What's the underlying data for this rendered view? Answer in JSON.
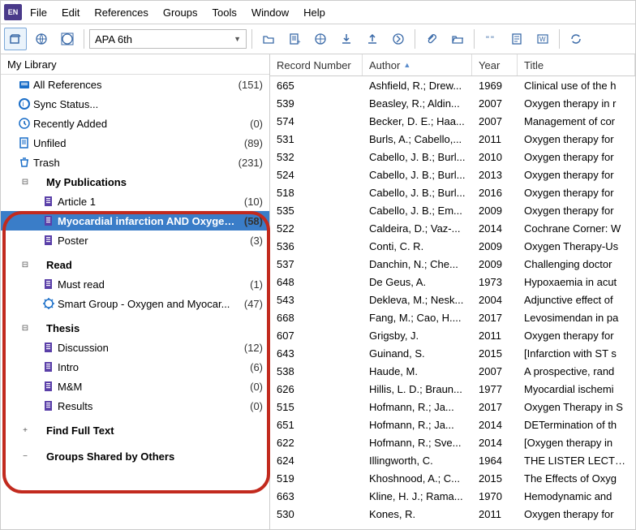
{
  "menubar": {
    "items": [
      "File",
      "Edit",
      "References",
      "Groups",
      "Tools",
      "Window",
      "Help"
    ],
    "logo": "EN"
  },
  "toolbar": {
    "style": "APA 6th"
  },
  "sidebar": {
    "header": "My Library",
    "top": [
      {
        "icon": "refs",
        "label": "All References",
        "count": "(151)"
      },
      {
        "icon": "sync",
        "label": "Sync Status..."
      },
      {
        "icon": "recent",
        "label": "Recently Added",
        "count": "(0)"
      },
      {
        "icon": "unfiled",
        "label": "Unfiled",
        "count": "(89)"
      },
      {
        "icon": "trash",
        "label": "Trash",
        "count": "(231)"
      }
    ],
    "groups": [
      {
        "name": "My Publications",
        "expanded": true,
        "items": [
          {
            "label": "Article 1",
            "count": "(10)"
          },
          {
            "label": "Myocardial infarction AND Oxygen ...",
            "count": "(58)",
            "selected": true
          },
          {
            "label": "Poster",
            "count": "(3)"
          }
        ]
      },
      {
        "name": "Read",
        "expanded": true,
        "items": [
          {
            "label": "Must read",
            "count": "(1)"
          },
          {
            "label": "Smart Group - Oxygen and Myocar...",
            "count": "(47)",
            "smart": true
          }
        ]
      },
      {
        "name": "Thesis",
        "expanded": true,
        "items": [
          {
            "label": "Discussion",
            "count": "(12)"
          },
          {
            "label": "Intro",
            "count": "(6)"
          },
          {
            "label": "M&M",
            "count": "(0)"
          },
          {
            "label": "Results",
            "count": "(0)"
          }
        ]
      }
    ],
    "bottom": [
      {
        "exp": "+",
        "label": "Find Full Text"
      },
      {
        "exp": "−",
        "label": "Groups Shared by Others"
      }
    ]
  },
  "columns": {
    "rec": "Record Number",
    "author": "Author",
    "year": "Year",
    "title": "Title"
  },
  "records": [
    {
      "n": "665",
      "a": "Ashfield, R.; Drew...",
      "y": "1969",
      "t": "Clinical use of the h"
    },
    {
      "n": "539",
      "a": "Beasley, R.; Aldin...",
      "y": "2007",
      "t": "Oxygen therapy in r"
    },
    {
      "n": "574",
      "a": "Becker, D. E.; Haa...",
      "y": "2007",
      "t": "Management of cor"
    },
    {
      "n": "531",
      "a": "Burls, A.; Cabello,...",
      "y": "2011",
      "t": "Oxygen therapy for"
    },
    {
      "n": "532",
      "a": "Cabello, J. B.; Burl...",
      "y": "2010",
      "t": "Oxygen therapy for"
    },
    {
      "n": "524",
      "a": "Cabello, J. B.; Burl...",
      "y": "2013",
      "t": "Oxygen therapy for"
    },
    {
      "n": "518",
      "a": "Cabello, J. B.; Burl...",
      "y": "2016",
      "t": "Oxygen therapy for"
    },
    {
      "n": "535",
      "a": "Cabello, J. B.; Em...",
      "y": "2009",
      "t": "Oxygen therapy for"
    },
    {
      "n": "522",
      "a": "Caldeira, D.; Vaz-...",
      "y": "2014",
      "t": "Cochrane Corner: W"
    },
    {
      "n": "536",
      "a": "Conti, C. R.",
      "y": "2009",
      "t": "Oxygen Therapy-Us"
    },
    {
      "n": "537",
      "a": "Danchin, N.; Che...",
      "y": "2009",
      "t": "Challenging doctor"
    },
    {
      "n": "648",
      "a": "De Geus, A.",
      "y": "1973",
      "t": "Hypoxaemia in acut"
    },
    {
      "n": "543",
      "a": "Dekleva, M.; Nesk...",
      "y": "2004",
      "t": "Adjunctive effect of"
    },
    {
      "n": "668",
      "a": "Fang, M.; Cao, H....",
      "y": "2017",
      "t": "Levosimendan in pa"
    },
    {
      "n": "607",
      "a": "Grigsby, J.",
      "y": "2011",
      "t": "Oxygen therapy for"
    },
    {
      "n": "643",
      "a": "Guinand, S.",
      "y": "2015",
      "t": "[Infarction with ST s"
    },
    {
      "n": "538",
      "a": "Haude, M.",
      "y": "2007",
      "t": "A prospective, rand"
    },
    {
      "n": "626",
      "a": "Hillis, L. D.; Braun...",
      "y": "1977",
      "t": "Myocardial ischemi"
    },
    {
      "n": "515",
      "a": "Hofmann, R.; Ja...",
      "y": "2017",
      "t": "Oxygen Therapy in S"
    },
    {
      "n": "651",
      "a": "Hofmann, R.; Ja...",
      "y": "2014",
      "t": "DETermination of th"
    },
    {
      "n": "622",
      "a": "Hofmann, R.; Sve...",
      "y": "2014",
      "t": "[Oxygen therapy in"
    },
    {
      "n": "624",
      "a": "Illingworth, C.",
      "y": "1964",
      "t": "THE LISTER LECTUR"
    },
    {
      "n": "519",
      "a": "Khoshnood, A.; C...",
      "y": "2015",
      "t": "The Effects of Oxyg"
    },
    {
      "n": "663",
      "a": "Kline, H. J.; Rama...",
      "y": "1970",
      "t": "Hemodynamic and"
    },
    {
      "n": "530",
      "a": "Kones, R.",
      "y": "2011",
      "t": "Oxygen therapy for"
    }
  ]
}
